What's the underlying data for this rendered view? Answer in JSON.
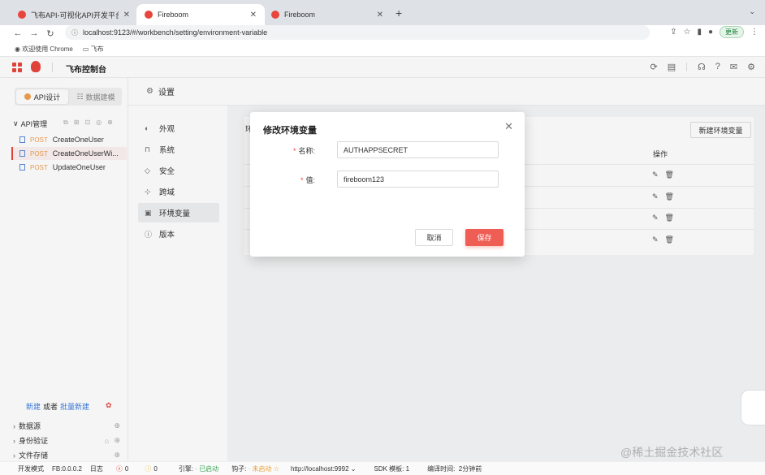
{
  "browser": {
    "tabs": [
      {
        "title": "飞布API-可视化API开发平台",
        "active": false
      },
      {
        "title": "Fireboom",
        "active": true
      },
      {
        "title": "Fireboom",
        "active": false
      }
    ],
    "url": "localhost:9123/#/workbench/setting/environment-variable",
    "update_label": "更新",
    "bookmarks": [
      "欢迎使用 Chrome",
      "飞布"
    ]
  },
  "app": {
    "title": "飞布控制台",
    "accent": "#e8453c"
  },
  "sidebar": {
    "tab_api": "API设计",
    "tab_data": "数据建模",
    "group_label": "API管理",
    "items": [
      {
        "method": "POST",
        "name": "CreateOneUser"
      },
      {
        "method": "POST",
        "name": "CreateOneUserWi..."
      },
      {
        "method": "POST",
        "name": "UpdateOneUser"
      }
    ],
    "new_link": "新建",
    "or_text": "或者",
    "batch_link": "批量新建",
    "sections": [
      "数据源",
      "身份验证",
      "文件存储"
    ]
  },
  "settings": {
    "title": "设置",
    "menu": [
      "外观",
      "系统",
      "安全",
      "跨域",
      "环境变量",
      "版本"
    ],
    "active_menu": "环境变量",
    "card_label": "环",
    "new_button": "新建环境变量",
    "op_header": "操作"
  },
  "modal": {
    "title": "修改环境变量",
    "name_label": "名称:",
    "name_value": "AUTHAPPSECRET",
    "value_label": "值:",
    "value_value": "fireboom123",
    "cancel": "取消",
    "save": "保存"
  },
  "statusbar": {
    "mode": "开发模式",
    "version": "FB:0.0.0.2",
    "log": "日志",
    "errors": "0",
    "warnings": "0",
    "engine_label": "引擎:",
    "engine_status": "已启动",
    "hook_label": "钩子:",
    "hook_status": "未启动",
    "host": "http://localhost:9992",
    "sdk": "SDK 模板: 1",
    "compile_label": "编译时间:",
    "compile_time": "2分钟前"
  },
  "watermark": "@稀土掘金技术社区"
}
